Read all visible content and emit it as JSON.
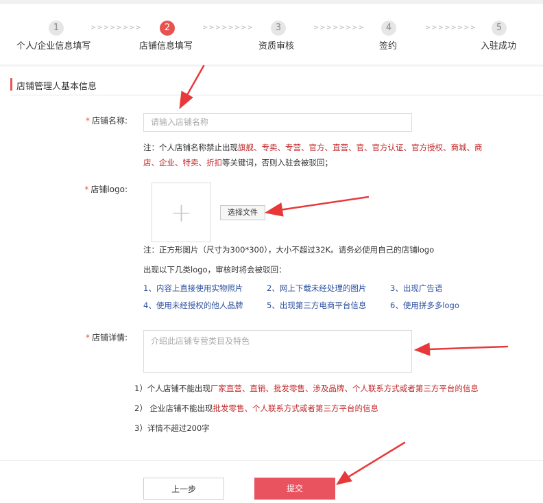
{
  "steps": [
    {
      "num": "1",
      "label": "个人/企业信息填写",
      "active": false
    },
    {
      "num": "2",
      "label": "店铺信息填写",
      "active": true
    },
    {
      "num": "3",
      "label": "资质审核",
      "active": false
    },
    {
      "num": "4",
      "label": "签约",
      "active": false
    },
    {
      "num": "5",
      "label": "入驻成功",
      "active": false
    }
  ],
  "step_separator": ">>>>>>>>",
  "section_title": "店铺管理人基本信息",
  "store_name": {
    "required_mark": "*",
    "label": "店铺名称:",
    "placeholder": "请输入店铺名称",
    "note_line1_prefix": "注：个人店铺名称禁止出现",
    "note_line1_keywords": "旗舰、专卖、专营、官方、直营、官、官方认证、官方授权、商城、商",
    "note_line2_keywords": "店、企业、特卖、折扣",
    "note_line2_suffix": "等关键词，否则入驻会被驳回；"
  },
  "store_logo": {
    "required_mark": "*",
    "label": "店铺logo:",
    "upload_symbol": "+",
    "file_button": "选择文件",
    "note": "注：正方形图片（尺寸为300*300），大小不超过32K。请务必使用自己的店铺logo",
    "reject_title": "出现以下几类logo，审核时将会被驳回：",
    "reject_items": [
      "1、内容上直接使用实物照片",
      "2、网上下载未经处理的图片",
      "3、出现广告语",
      "4、使用未经授权的他人品牌",
      "5、出现第三方电商平台信息",
      "6、使用拼多多logo"
    ]
  },
  "store_detail": {
    "required_mark": "*",
    "label": "店铺详情:",
    "placeholder": "介绍此店铺专营类目及特色",
    "rule1_prefix": "1）个人店铺不能出现",
    "rule1_keywords": "厂家直营、直销、批发零售、涉及品牌、个人联系方式或者第三方平台的信息",
    "rule2_prefix": "2） 企业店铺不能出现",
    "rule2_keywords": "批发零售、个人联系方式或者第三方平台的信息",
    "rule3": "3）详情不超过200字"
  },
  "buttons": {
    "prev": "上一步",
    "submit": "提交"
  },
  "colors": {
    "accent": "#e9534f",
    "keyword_red": "#c0282a",
    "link_blue": "#2b4fa0",
    "annotation_arrow": "#e8393a"
  }
}
